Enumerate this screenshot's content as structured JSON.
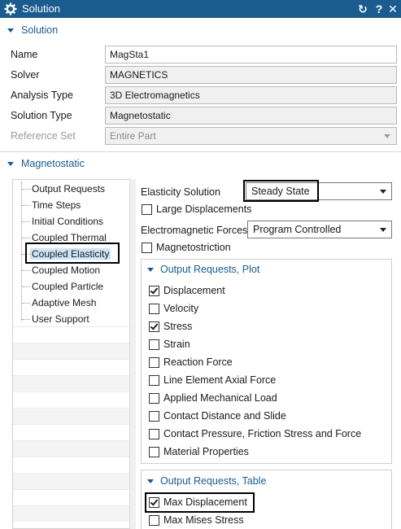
{
  "window": {
    "title": "Solution",
    "icons": [
      "gear-icon",
      "reset-icon",
      "help-icon",
      "close-icon"
    ],
    "reset_glyph": "↻",
    "help_glyph": "?",
    "close_glyph": "✕"
  },
  "solution_section": {
    "header": "Solution",
    "rows": [
      {
        "label": "Name",
        "value": "MagSta1",
        "state": "editable"
      },
      {
        "label": "Solver",
        "value": "MAGNETICS",
        "state": "readonly"
      },
      {
        "label": "Analysis Type",
        "value": "3D Electromagnetics",
        "state": "readonly"
      },
      {
        "label": "Solution Type",
        "value": "Magnetostatic",
        "state": "readonly"
      },
      {
        "label": "Reference Set",
        "value": "Entire Part",
        "state": "disabled"
      }
    ]
  },
  "magnetostatic_section": {
    "header": "Magnetostatic",
    "tree": [
      {
        "label": "Output Requests"
      },
      {
        "label": "Time Steps"
      },
      {
        "label": "Initial Conditions"
      },
      {
        "label": "Coupled Thermal"
      },
      {
        "label": "Coupled Elasticity",
        "selected": true
      },
      {
        "label": "Coupled Motion"
      },
      {
        "label": "Coupled Particle"
      },
      {
        "label": "Adaptive Mesh"
      },
      {
        "label": "User Support"
      }
    ],
    "elasticity_solution": {
      "label": "Elasticity Solution",
      "value": "Steady State"
    },
    "large_displacements": {
      "label": "Large Displacements",
      "checked": false
    },
    "em_forces": {
      "label": "Electromagnetic Forces",
      "value": "Program Controlled"
    },
    "magnetostriction": {
      "label": "Magnetostriction",
      "checked": false
    },
    "plot_group": {
      "header": "Output Requests, Plot",
      "items": [
        {
          "label": "Displacement",
          "checked": true
        },
        {
          "label": "Velocity",
          "checked": false
        },
        {
          "label": "Stress",
          "checked": true
        },
        {
          "label": "Strain",
          "checked": false
        },
        {
          "label": "Reaction Force",
          "checked": false
        },
        {
          "label": "Line Element Axial Force",
          "checked": false
        },
        {
          "label": "Applied Mechanical Load",
          "checked": false
        },
        {
          "label": "Contact Distance and Slide",
          "checked": false
        },
        {
          "label": "Contact Pressure, Friction Stress and Force",
          "checked": false
        },
        {
          "label": "Material Properties",
          "checked": false
        }
      ]
    },
    "table_group": {
      "header": "Output Requests, Table",
      "items": [
        {
          "label": "Max Displacement",
          "checked": true
        },
        {
          "label": "Max Mises Stress",
          "checked": false
        }
      ]
    }
  }
}
